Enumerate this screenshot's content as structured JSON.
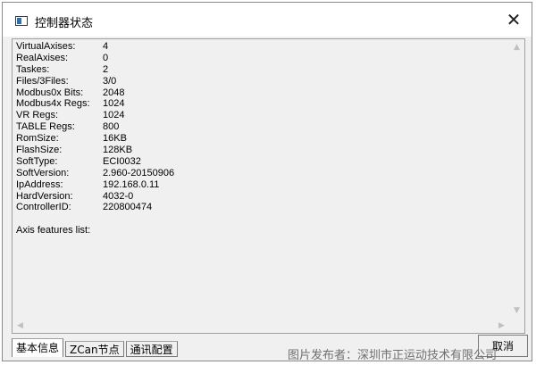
{
  "window": {
    "title": "控制器状态",
    "close_symbol": "✕"
  },
  "info": [
    {
      "label": "VirtualAxises:",
      "value": "4"
    },
    {
      "label": "RealAxises:",
      "value": "0"
    },
    {
      "label": "Taskes:",
      "value": "2"
    },
    {
      "label": "Files/3Files:",
      "value": "3/0"
    },
    {
      "label": "Modbus0x Bits:",
      "value": "2048"
    },
    {
      "label": "Modbus4x Regs:",
      "value": "1024"
    },
    {
      "label": "VR Regs:",
      "value": "1024"
    },
    {
      "label": "TABLE Regs:",
      "value": "800"
    },
    {
      "label": "RomSize:",
      "value": "16KB"
    },
    {
      "label": "FlashSize:",
      "value": "128KB"
    },
    {
      "label": "SoftType:",
      "value": "ECI0032"
    },
    {
      "label": "SoftVersion:",
      "value": "2.960-20150906"
    },
    {
      "label": "IpAddress:",
      "value": "192.168.0.11"
    },
    {
      "label": "HardVersion:",
      "value": "4032-0"
    },
    {
      "label": "ControllerID:",
      "value": "220800474"
    }
  ],
  "axis_features_label": "Axis features list:",
  "tabs": [
    {
      "label": "基本信息",
      "active": true
    },
    {
      "label": "ZCan节点",
      "active": false
    },
    {
      "label": "通讯配置",
      "active": false
    }
  ],
  "buttons": {
    "cancel": "取消"
  },
  "watermark": "图片发布者：深圳市正运动技术有限公司",
  "icons": {
    "app": "window-app-icon",
    "close": "close-icon",
    "scroll_up": "scroll-up-arrow-icon",
    "scroll_down": "scroll-down-arrow-icon",
    "scroll_left": "scroll-left-arrow-icon",
    "scroll_right": "scroll-right-arrow-icon"
  }
}
